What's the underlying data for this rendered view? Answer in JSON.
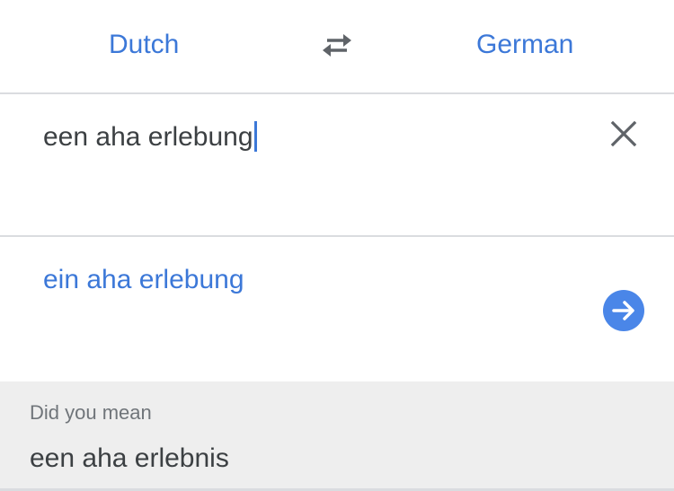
{
  "language_bar": {
    "source_language": "Dutch",
    "target_language": "German",
    "swap_icon": "swap-arrows-icon"
  },
  "input": {
    "value": "een aha erlebung",
    "clear_icon": "close-icon"
  },
  "result": {
    "translation": "ein aha erlebung",
    "action_icon": "arrow-right-circle-icon"
  },
  "suggestion": {
    "label": "Did you mean",
    "text": "een aha erlebnis"
  },
  "colors": {
    "accent": "#3c78d8",
    "button": "#4a86e8",
    "text": "#3c4043",
    "muted": "#70757a",
    "suggest_bg": "#eeeeee",
    "divider": "#dadce0"
  }
}
